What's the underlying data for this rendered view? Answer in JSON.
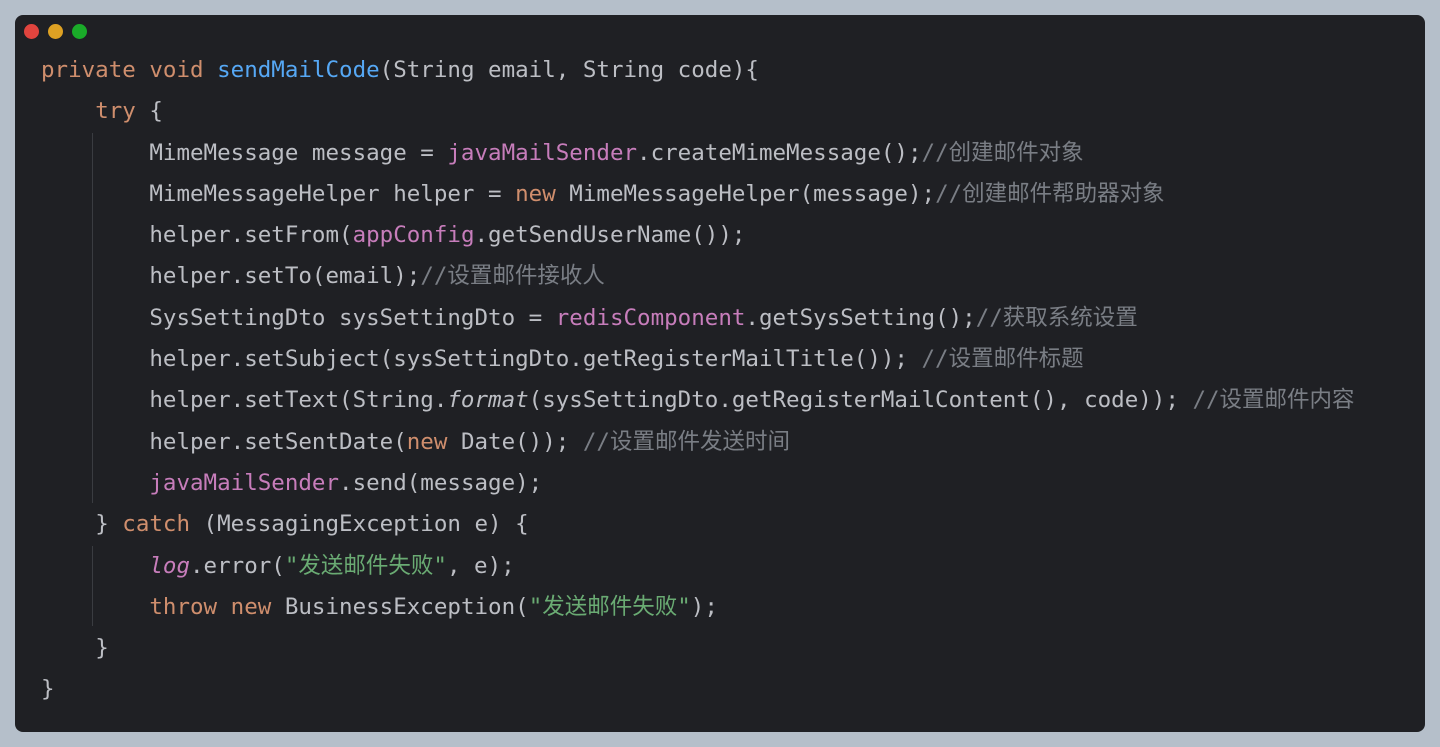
{
  "window": {
    "buttons": [
      "close",
      "minimize",
      "zoom"
    ]
  },
  "code": {
    "language": "Java",
    "lines": [
      {
        "indent": "",
        "tokens": [
          {
            "t": "private",
            "c": "kw"
          },
          {
            "t": " "
          },
          {
            "t": "void",
            "c": "kw"
          },
          {
            "t": " "
          },
          {
            "t": "sendMailCode",
            "c": "fn"
          },
          {
            "t": "(String email, String code){"
          }
        ]
      },
      {
        "indent": "    ",
        "tokens": [
          {
            "t": "try",
            "c": "kw"
          },
          {
            "t": " {"
          }
        ]
      },
      {
        "indent": "        ",
        "tokens": [
          {
            "t": "MimeMessage message = "
          },
          {
            "t": "javaMailSender",
            "c": "fld"
          },
          {
            "t": ".createMimeMessage();"
          },
          {
            "t": "//创建邮件对象",
            "c": "cmt"
          }
        ]
      },
      {
        "indent": "        ",
        "tokens": [
          {
            "t": "MimeMessageHelper helper = "
          },
          {
            "t": "new",
            "c": "kw"
          },
          {
            "t": " MimeMessageHelper(message);"
          },
          {
            "t": "//创建邮件帮助器对象",
            "c": "cmt"
          }
        ]
      },
      {
        "indent": "        ",
        "tokens": [
          {
            "t": "helper.setFrom("
          },
          {
            "t": "appConfig",
            "c": "fld"
          },
          {
            "t": ".getSendUserName());"
          }
        ]
      },
      {
        "indent": "        ",
        "tokens": [
          {
            "t": "helper.setTo(email);"
          },
          {
            "t": "//设置邮件接收人",
            "c": "cmt"
          }
        ]
      },
      {
        "indent": "        ",
        "tokens": [
          {
            "t": "SysSettingDto sysSettingDto = "
          },
          {
            "t": "redisComponent",
            "c": "fld"
          },
          {
            "t": ".getSysSetting();"
          },
          {
            "t": "//获取系统设置",
            "c": "cmt"
          }
        ]
      },
      {
        "indent": "        ",
        "tokens": [
          {
            "t": "helper.setSubject(sysSettingDto.getRegisterMailTitle()); "
          },
          {
            "t": "//设置邮件标题",
            "c": "cmt"
          }
        ]
      },
      {
        "indent": "        ",
        "tokens": [
          {
            "t": "helper.setText(String."
          },
          {
            "t": "format",
            "c": "itl"
          },
          {
            "t": "(sysSettingDto.getRegisterMailContent(), code)); "
          },
          {
            "t": "//设置邮件内容",
            "c": "cmt"
          }
        ]
      },
      {
        "indent": "        ",
        "tokens": [
          {
            "t": "helper.setSentDate("
          },
          {
            "t": "new",
            "c": "kw"
          },
          {
            "t": " Date()); "
          },
          {
            "t": "//设置邮件发送时间",
            "c": "cmt"
          }
        ]
      },
      {
        "indent": "        ",
        "tokens": [
          {
            "t": "javaMailSender",
            "c": "fld"
          },
          {
            "t": ".send(message);"
          }
        ]
      },
      {
        "indent": "    ",
        "tokens": [
          {
            "t": "} "
          },
          {
            "t": "catch",
            "c": "kw"
          },
          {
            "t": " (MessagingException e) {"
          }
        ]
      },
      {
        "indent": "        ",
        "tokens": [
          {
            "t": "log",
            "c": "fldi"
          },
          {
            "t": ".error("
          },
          {
            "t": "\"发送邮件失败\"",
            "c": "str"
          },
          {
            "t": ", e);"
          }
        ]
      },
      {
        "indent": "        ",
        "tokens": [
          {
            "t": "throw",
            "c": "kw"
          },
          {
            "t": " "
          },
          {
            "t": "new",
            "c": "kw"
          },
          {
            "t": " BusinessException("
          },
          {
            "t": "\"发送邮件失败\"",
            "c": "str"
          },
          {
            "t": ");"
          }
        ]
      },
      {
        "indent": "    ",
        "tokens": [
          {
            "t": "}"
          }
        ]
      },
      {
        "indent": "",
        "tokens": [
          {
            "t": "}"
          }
        ]
      }
    ]
  },
  "colors": {
    "background": "#1f2024",
    "page": "#b5bfca",
    "keyword": "#cf8e6d",
    "method": "#56a8f5",
    "field": "#c77dbb",
    "comment": "#7a7e85",
    "string": "#6aab73",
    "text": "#bcbec4"
  }
}
